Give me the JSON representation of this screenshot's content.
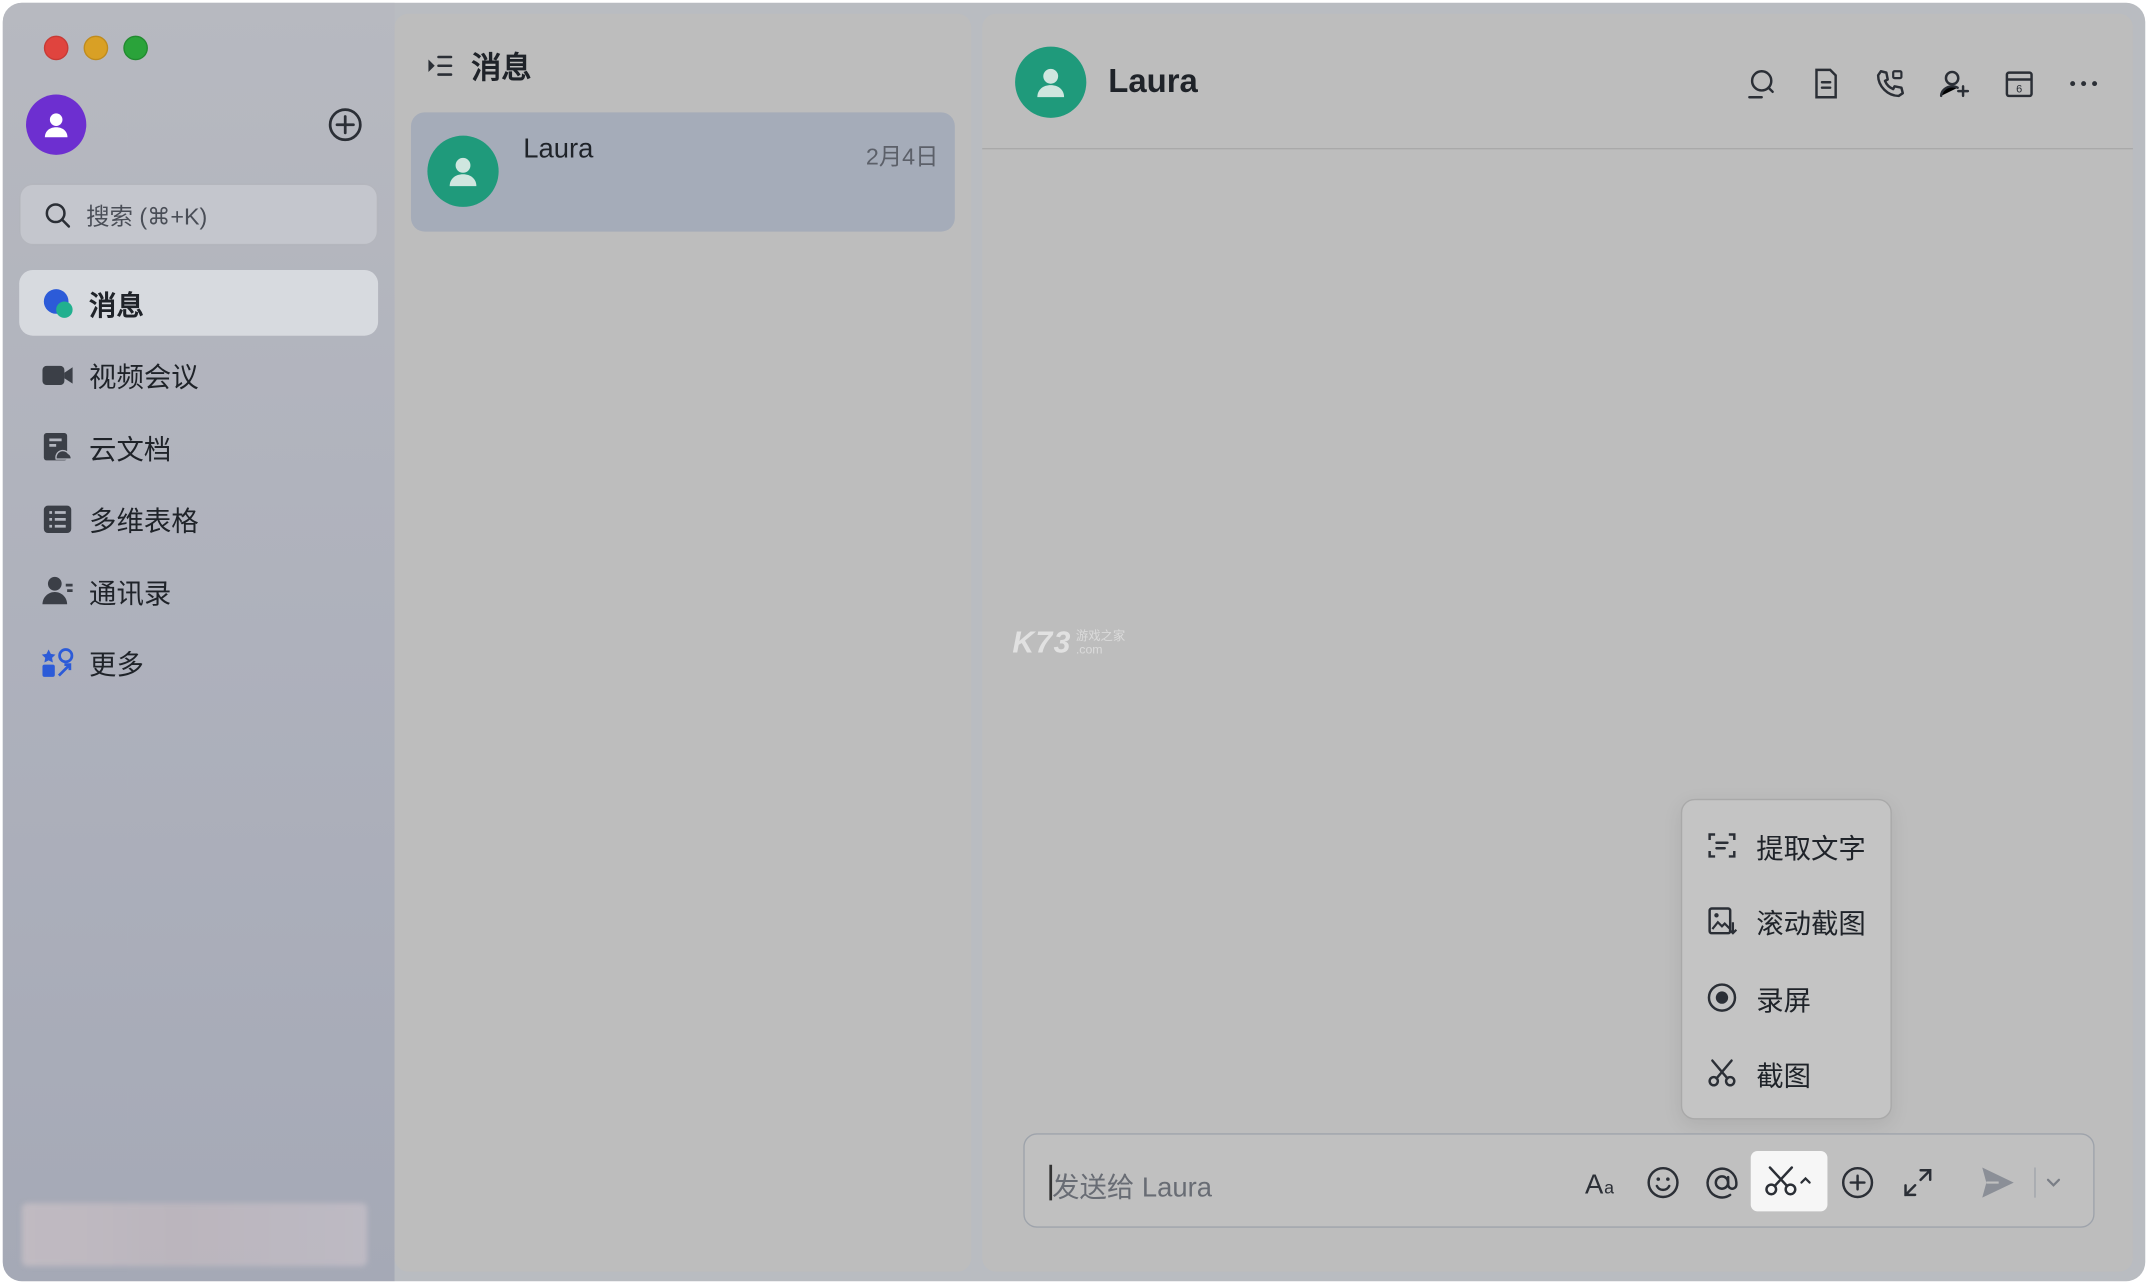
{
  "window": {
    "controls": [
      "close",
      "minimize",
      "zoom"
    ]
  },
  "sidebar": {
    "search": {
      "placeholder": "搜索 (⌘+K)"
    },
    "items": [
      {
        "label": "消息",
        "icon": "chat-bubbles-icon",
        "active": true
      },
      {
        "label": "视频会议",
        "icon": "video-camera-icon",
        "active": false
      },
      {
        "label": "云文档",
        "icon": "cloud-docs-icon",
        "active": false
      },
      {
        "label": "多维表格",
        "icon": "table-icon",
        "active": false
      },
      {
        "label": "通讯录",
        "icon": "contacts-icon",
        "active": false
      },
      {
        "label": "更多",
        "icon": "apps-more-icon",
        "active": false
      }
    ]
  },
  "list": {
    "title": "消息",
    "conversations": [
      {
        "name": "Laura",
        "date": "2月4日"
      }
    ]
  },
  "chat": {
    "contact_name": "Laura",
    "header_tools": [
      "search-chat-icon",
      "docs-icon",
      "phone-call-icon",
      "add-member-icon",
      "calendar-icon",
      "more-icon"
    ],
    "watermark": {
      "main": "K73",
      "sub1": "游戏之家",
      "sub2": ".com"
    },
    "screenshot_menu": [
      {
        "label": "提取文字",
        "icon": "extract-text-icon"
      },
      {
        "label": "滚动截图",
        "icon": "scroll-capture-icon"
      },
      {
        "label": "录屏",
        "icon": "record-screen-icon"
      },
      {
        "label": "截图",
        "icon": "scissors-icon"
      }
    ],
    "composer": {
      "placeholder": "发送给 Laura",
      "tools": [
        "text-format-icon",
        "emoji-icon",
        "mention-icon",
        "screenshot-icon",
        "add-icon",
        "expand-icon",
        "send-icon",
        "chevron-down-icon"
      ]
    }
  },
  "colors": {
    "accent_green": "#1f9a7b",
    "avatar_purple": "#6d2fd0",
    "active_blue": "#2c5bd8"
  }
}
